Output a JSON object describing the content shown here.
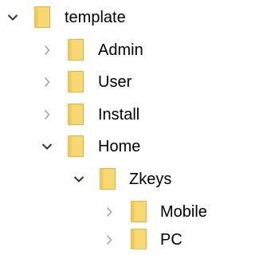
{
  "tree": {
    "nodes": [
      {
        "label": "template",
        "state": "expanded",
        "depth": 0
      },
      {
        "label": "Admin",
        "state": "collapsed",
        "depth": 1
      },
      {
        "label": "User",
        "state": "collapsed",
        "depth": 1
      },
      {
        "label": "Install",
        "state": "collapsed",
        "depth": 1
      },
      {
        "label": "Home",
        "state": "expanded",
        "depth": 1
      },
      {
        "label": "Zkeys",
        "state": "expanded",
        "depth": 2
      },
      {
        "label": "Mobile",
        "state": "collapsed",
        "depth": 3
      },
      {
        "label": "PC",
        "state": "collapsed",
        "depth": 3
      }
    ]
  },
  "colors": {
    "folder_fill": "#F8D775",
    "folder_edge": "#E0B040",
    "folder_tab": "#F3C94F",
    "chevron_expanded": "#333333",
    "chevron_collapsed": "#A6A6A6"
  },
  "icons": {
    "folder": "folder-icon",
    "expanded": "chevron-down-icon",
    "collapsed": "chevron-right-icon"
  }
}
